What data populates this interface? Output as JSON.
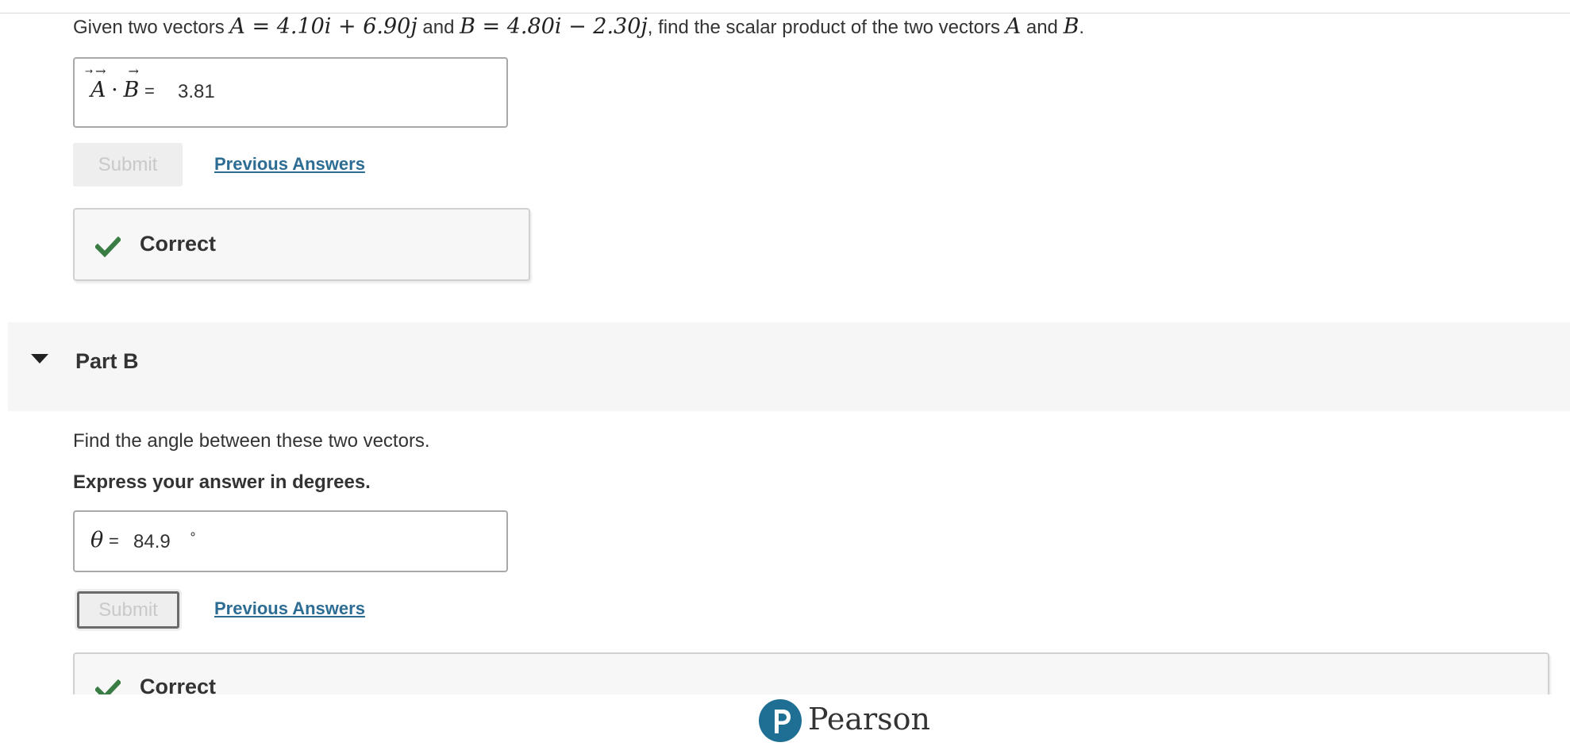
{
  "part_a": {
    "question": {
      "t1": "Given two vectors ",
      "m1": "A = 4.10i + 6.90j",
      "t2": " and ",
      "m2": "B = 4.80i − 2.30j",
      "t3": ", find the scalar product of the two vectors ",
      "m3": "A",
      "t4": " and ",
      "m4": "B",
      "t5": "."
    },
    "answer_label_a": "A",
    "answer_label_dot": "·",
    "answer_label_b": "B",
    "answer_equals": "=",
    "answer_value": "3.81",
    "submit_label": "Submit",
    "previous_answers_label": "Previous Answers",
    "feedback": "Correct"
  },
  "part_b": {
    "header": "Part B",
    "prompt": "Find the angle between these two vectors.",
    "instruction": "Express your answer in degrees.",
    "answer_symbol": "θ",
    "answer_equals": "=",
    "answer_value": "84.9",
    "answer_unit": "∘",
    "submit_label": "Submit",
    "previous_answers_label": "Previous Answers",
    "feedback": "Correct"
  },
  "footer": {
    "brand": "Pearson"
  },
  "colors": {
    "link": "#2d6c93",
    "check": "#3a7d44",
    "brand": "#1f6f95"
  }
}
